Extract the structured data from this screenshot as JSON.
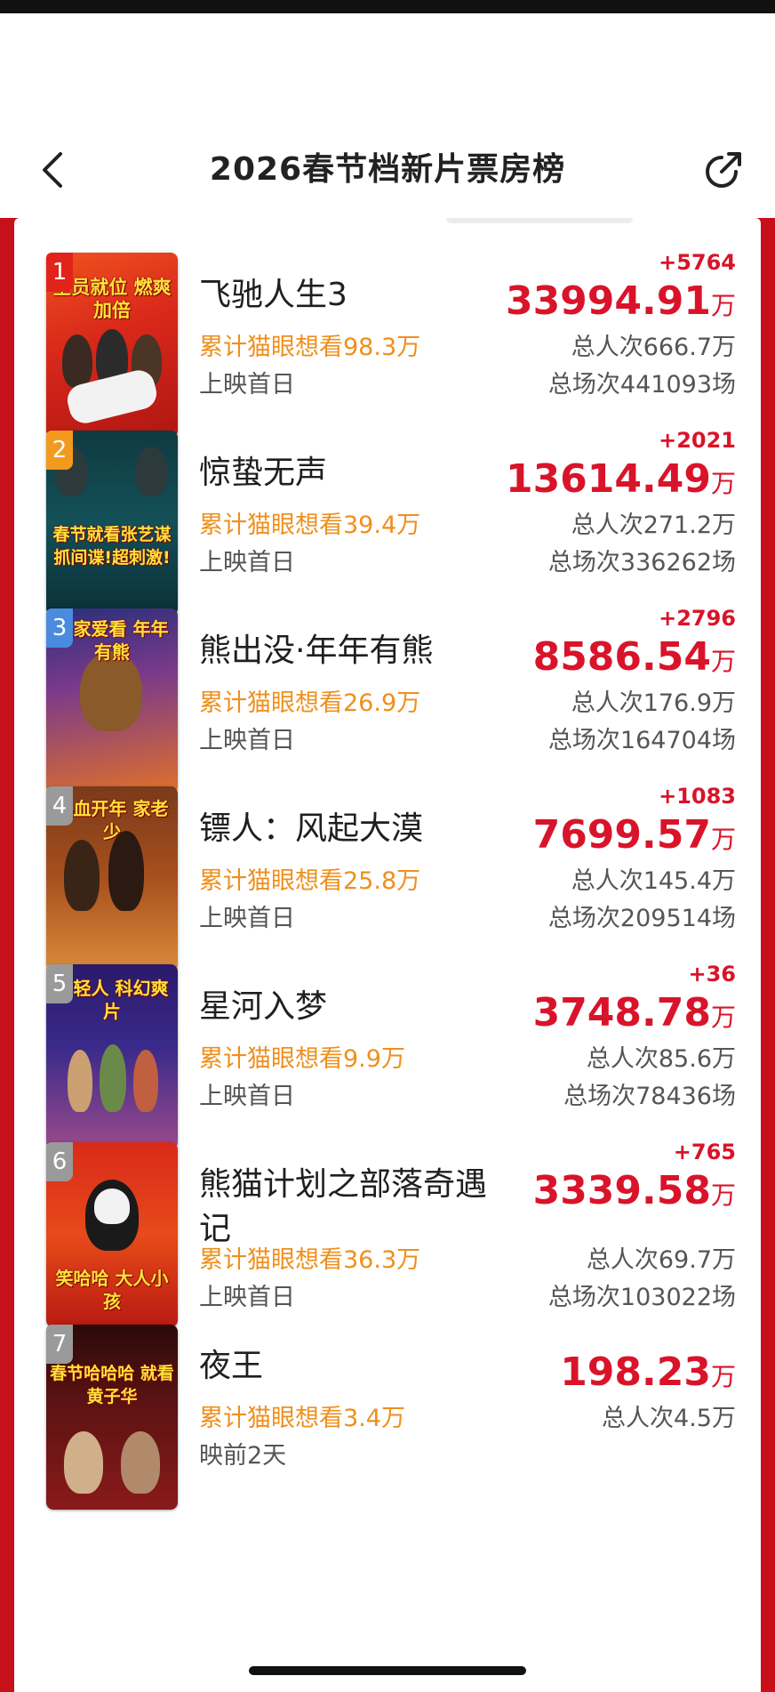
{
  "header": {
    "title": "2026春节档新片票房榜"
  },
  "colors": {
    "frame_red": "#c8101a",
    "box_red": "#d9142a",
    "wish_orange": "#ef8f1c",
    "badge_red": "#e2231a",
    "badge_orange": "#f39a1e",
    "badge_blue": "#4a8be0",
    "badge_gray": "#9a9a9a"
  },
  "icons": {
    "back": "chevron-left-icon",
    "share": "share-icon"
  },
  "movies": [
    {
      "rank": "1",
      "name": "飞驰人生3",
      "wish": "累计猫眼想看98.3万",
      "release": "上映首日",
      "delta": "+5764",
      "box": "33994.91",
      "unit": "万",
      "viewers": "总人次666.7万",
      "sessions": "总场次441093场",
      "poster_text": "全员就位 燃爽加倍"
    },
    {
      "rank": "2",
      "name": "惊蛰无声",
      "wish": "累计猫眼想看39.4万",
      "release": "上映首日",
      "delta": "+2021",
      "box": "13614.49",
      "unit": "万",
      "viewers": "总人次271.2万",
      "sessions": "总场次336262场",
      "poster_text": "春节就看张艺谋 抓间谍!超刺激!"
    },
    {
      "rank": "3",
      "name": "熊出没·年年有熊",
      "wish": "累计猫眼想看26.9万",
      "release": "上映首日",
      "delta": "+2796",
      "box": "8586.54",
      "unit": "万",
      "viewers": "总人次176.9万",
      "sessions": "总场次164704场",
      "poster_text": "全家爱看 年年有熊"
    },
    {
      "rank": "4",
      "name": "镖人：风起大漠",
      "wish": "累计猫眼想看25.8万",
      "release": "上映首日",
      "delta": "+1083",
      "box": "7699.57",
      "unit": "万",
      "viewers": "总人次145.4万",
      "sessions": "总场次209514场",
      "poster_text": "热血开年 家老少"
    },
    {
      "rank": "5",
      "name": "星河入梦",
      "wish": "累计猫眼想看9.9万",
      "release": "上映首日",
      "delta": "+36",
      "box": "3748.78",
      "unit": "万",
      "viewers": "总人次85.6万",
      "sessions": "总场次78436场",
      "poster_text": "年轻人 科幻爽片"
    },
    {
      "rank": "6",
      "name": "熊猫计划之部落奇遇记",
      "wish": "累计猫眼想看36.3万",
      "release": "上映首日",
      "delta": "+765",
      "box": "3339.58",
      "unit": "万",
      "viewers": "总人次69.7万",
      "sessions": "总场次103022场",
      "poster_text": "笑哈哈 大人小孩"
    },
    {
      "rank": "7",
      "name": "夜王",
      "wish": "累计猫眼想看3.4万",
      "release": "映前2天",
      "delta": "",
      "box": "198.23",
      "unit": "万",
      "viewers": "总人次4.5万",
      "sessions": "",
      "poster_text": "春节哈哈哈 就看黄子华"
    }
  ]
}
